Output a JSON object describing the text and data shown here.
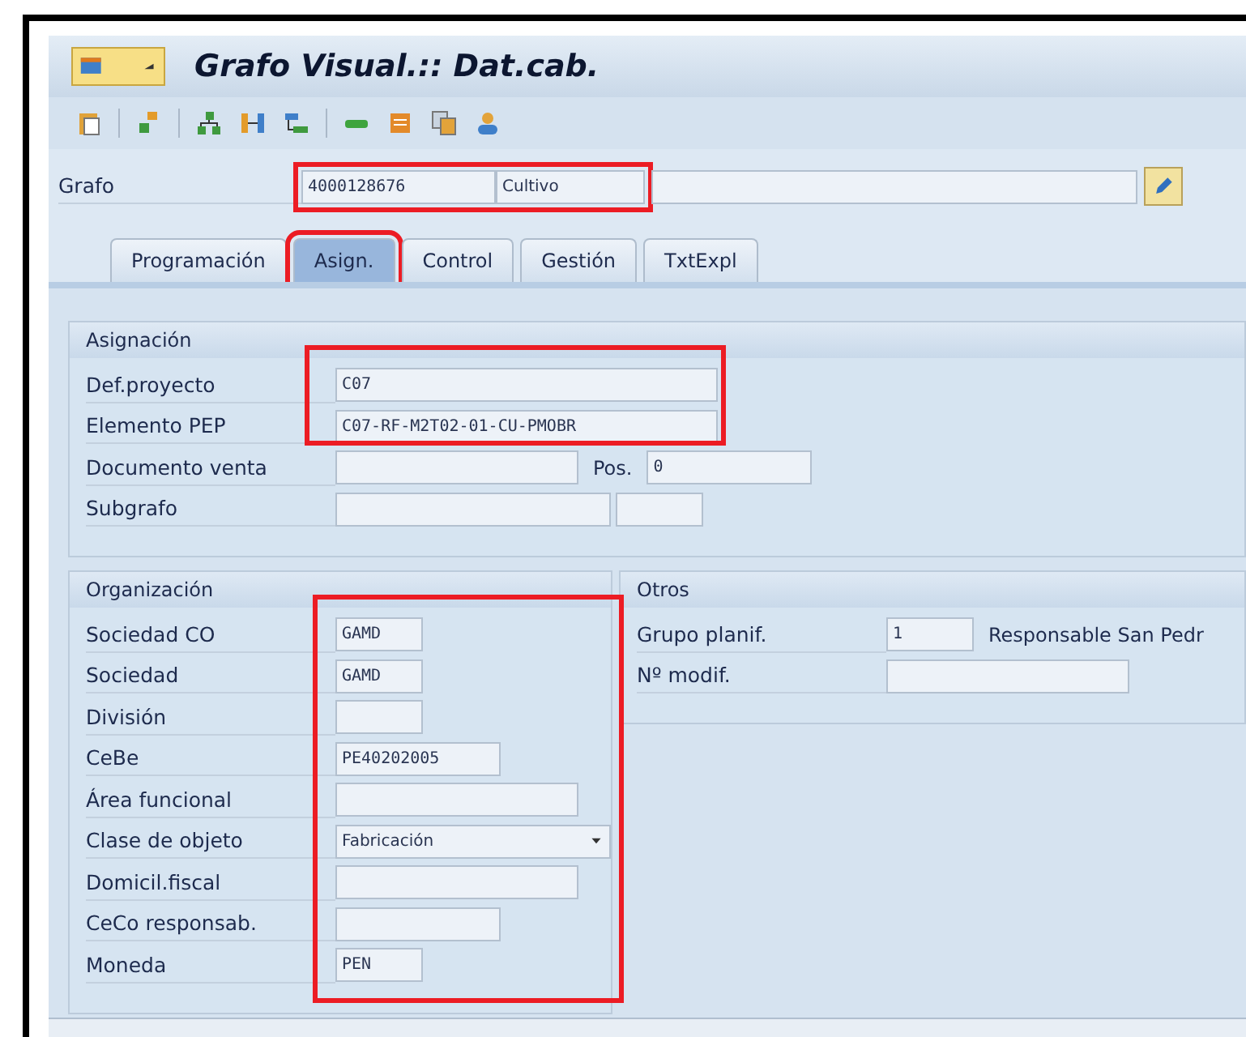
{
  "window": {
    "title": "Grafo Visual.:: Dat.cab."
  },
  "header": {
    "label": "Grafo",
    "number": "4000128676",
    "description": "Cultivo",
    "highlighted": true
  },
  "tabs": [
    {
      "label": "Programación",
      "selected": false,
      "highlighted": false
    },
    {
      "label": "Asign.",
      "selected": true,
      "highlighted": true
    },
    {
      "label": "Control",
      "selected": false,
      "highlighted": false
    },
    {
      "label": "Gestión",
      "selected": false,
      "highlighted": false
    },
    {
      "label": "TxtExpl",
      "selected": false,
      "highlighted": false
    }
  ],
  "asignacion": {
    "title": "Asignación",
    "highlighted": true,
    "rows": [
      {
        "label": "Def.proyecto",
        "fields": [
          {
            "kind": "text",
            "value": "C07"
          }
        ]
      },
      {
        "label": "Elemento PEP",
        "fields": [
          {
            "kind": "text",
            "value": "C07-RF-M2T02-01-CU-PMOBR"
          }
        ]
      },
      {
        "label": "Documento venta",
        "fields": [
          {
            "kind": "text"
          },
          {
            "kind": "caption",
            "value": "Pos."
          },
          {
            "kind": "text",
            "value": "0"
          }
        ]
      },
      {
        "label": "Subgrafo",
        "fields": [
          {
            "kind": "text"
          },
          {
            "kind": "text"
          }
        ]
      }
    ]
  },
  "organizacion": {
    "title": "Organización",
    "highlighted": true,
    "rows": [
      {
        "label": "Sociedad CO",
        "fields": [
          {
            "kind": "text",
            "value": "GAMD"
          }
        ]
      },
      {
        "label": "Sociedad",
        "fields": [
          {
            "kind": "text",
            "value": "GAMD"
          }
        ]
      },
      {
        "label": "División",
        "fields": [
          {
            "kind": "text"
          }
        ]
      },
      {
        "label": "CeBe",
        "fields": [
          {
            "kind": "text",
            "value": "PE40202005"
          }
        ]
      },
      {
        "label": "Área funcional",
        "fields": [
          {
            "kind": "text"
          }
        ]
      },
      {
        "label": "Clase de objeto",
        "fields": [
          {
            "kind": "dropdown",
            "value": "Fabricación"
          }
        ]
      },
      {
        "label": "Domicil.fiscal",
        "fields": [
          {
            "kind": "text"
          }
        ]
      },
      {
        "label": "CeCo responsab.",
        "fields": [
          {
            "kind": "text"
          }
        ]
      },
      {
        "label": "Moneda",
        "fields": [
          {
            "kind": "text",
            "value": "PEN"
          }
        ]
      }
    ]
  },
  "otros": {
    "title": "Otros",
    "rows": [
      {
        "label": "Grupo planif.",
        "fields": [
          {
            "kind": "text",
            "value": "1"
          },
          {
            "kind": "caption",
            "value": "Responsable San Pedr"
          }
        ]
      },
      {
        "label": "Nº modif.",
        "fields": [
          {
            "kind": "text"
          }
        ]
      }
    ]
  }
}
